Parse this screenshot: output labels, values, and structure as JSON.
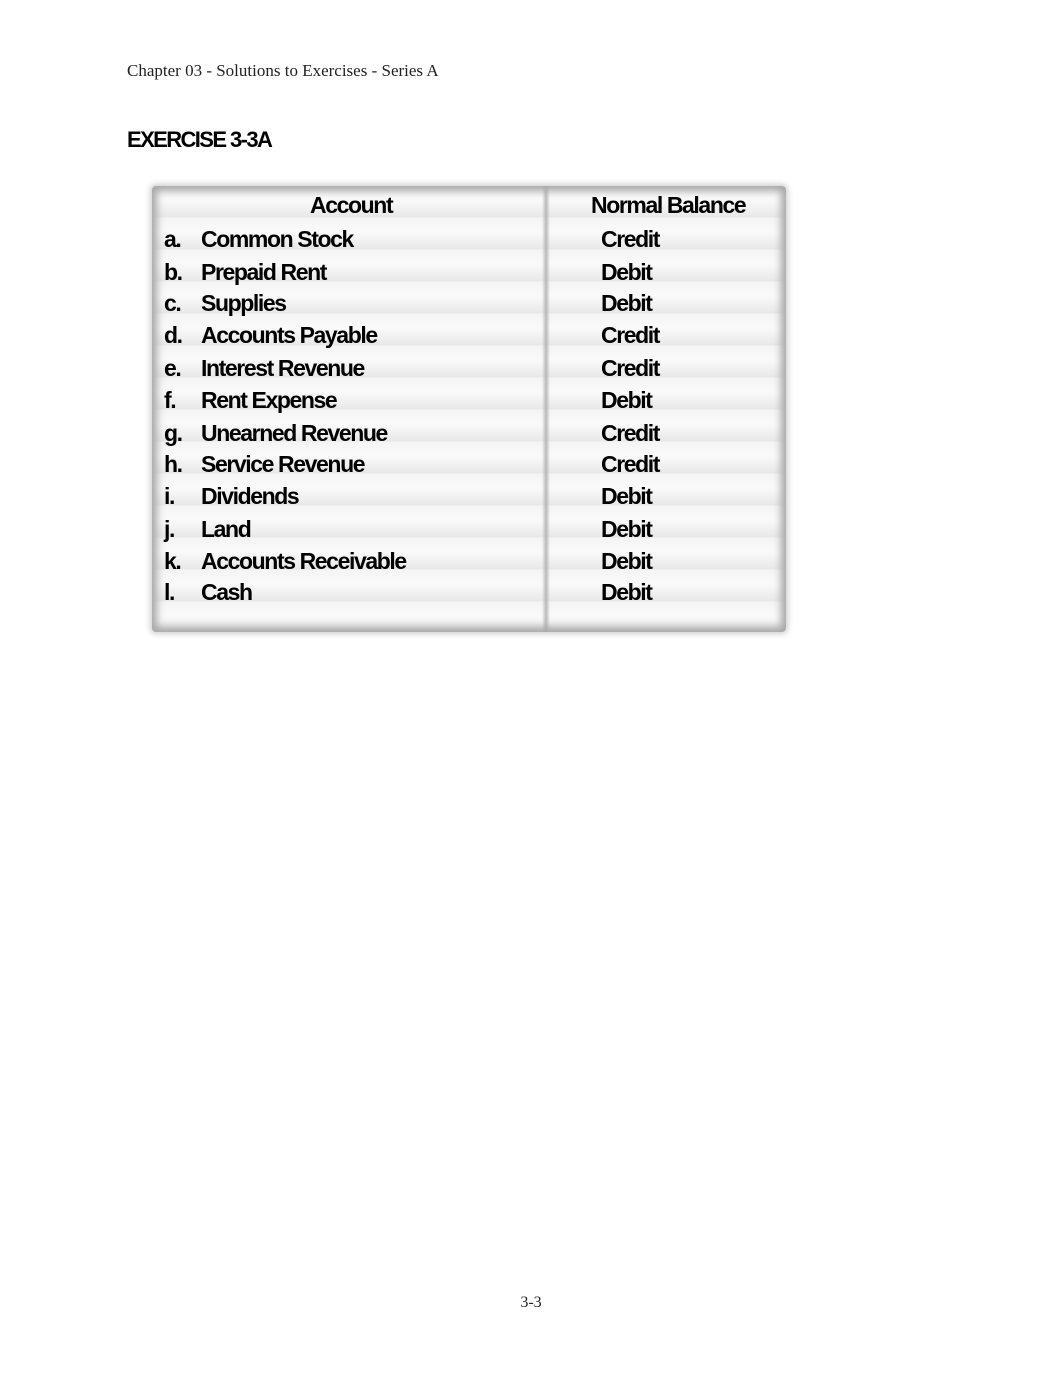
{
  "header": {
    "running_title": "Chapter 03 - Solutions to Exercises - Series A"
  },
  "exercise": {
    "title": "EXERCISE 3-3A"
  },
  "table": {
    "columns": [
      "Account",
      "Normal Balance"
    ],
    "rows": [
      {
        "letter": "a.",
        "account": "Common Stock",
        "balance": "Credit"
      },
      {
        "letter": "b.",
        "account": "Prepaid Rent",
        "balance": "Debit"
      },
      {
        "letter": "c.",
        "account": "Supplies",
        "balance": "Debit"
      },
      {
        "letter": "d.",
        "account": "Accounts Payable",
        "balance": "Credit"
      },
      {
        "letter": "e.",
        "account": "Interest Revenue",
        "balance": "Credit"
      },
      {
        "letter": "f.",
        "account": "Rent Expense",
        "balance": "Debit"
      },
      {
        "letter": "g.",
        "account": "Unearned Revenue",
        "balance": "Credit"
      },
      {
        "letter": "h.",
        "account": "Service Revenue",
        "balance": "Credit"
      },
      {
        "letter": "i.",
        "account": "Dividends",
        "balance": "Debit"
      },
      {
        "letter": "j.",
        "account": "Land",
        "balance": "Debit"
      },
      {
        "letter": "k.",
        "account": "Accounts Receivable",
        "balance": "Debit"
      },
      {
        "letter": "l.",
        "account": "Cash",
        "balance": "Debit"
      }
    ]
  },
  "footer": {
    "page_number": "3-3"
  }
}
